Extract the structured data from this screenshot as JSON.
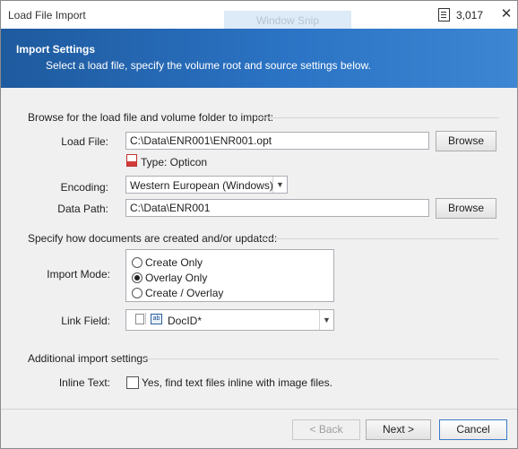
{
  "window": {
    "title": "Load File Import",
    "snip_label": "Window Snip",
    "doc_count": "3,017",
    "close_symbol": "✕"
  },
  "banner": {
    "heading": "Import Settings",
    "subtext": "Select a load file, specify the volume root and source settings below."
  },
  "browse_section": {
    "heading": "Browse for the load file and volume folder to import:",
    "load_file_label": "Load File:",
    "load_file_value": "C:\\Data\\ENR001\\ENR001.opt",
    "browse_label": "Browse",
    "type_text": "Type: Opticon",
    "encoding_label": "Encoding:",
    "encoding_value": "Western European (Windows)",
    "data_path_label": "Data Path:",
    "data_path_value": "C:\\Data\\ENR001",
    "browse2_label": "Browse"
  },
  "docs_section": {
    "heading": "Specify how documents are created and/or updated:",
    "import_mode_label": "Import Mode:",
    "modes": [
      {
        "label": "Create Only",
        "selected": false
      },
      {
        "label": "Overlay Only",
        "selected": true
      },
      {
        "label": "Create / Overlay",
        "selected": false
      }
    ],
    "link_field_label": "Link Field:",
    "link_field_value": "DocID*",
    "link_icon_text": "ab"
  },
  "additional_section": {
    "heading": "Additional import settings",
    "inline_label": "Inline Text:",
    "inline_checkbox_text": "Yes, find text files inline with image files.",
    "inline_checked": false
  },
  "footer": {
    "back_label": "< Back",
    "next_label": "Next >",
    "cancel_label": "Cancel"
  },
  "colors": {
    "banner_start": "#1e5a9e",
    "banner_end": "#3c86d3",
    "accent_border": "#3a7bc9"
  }
}
